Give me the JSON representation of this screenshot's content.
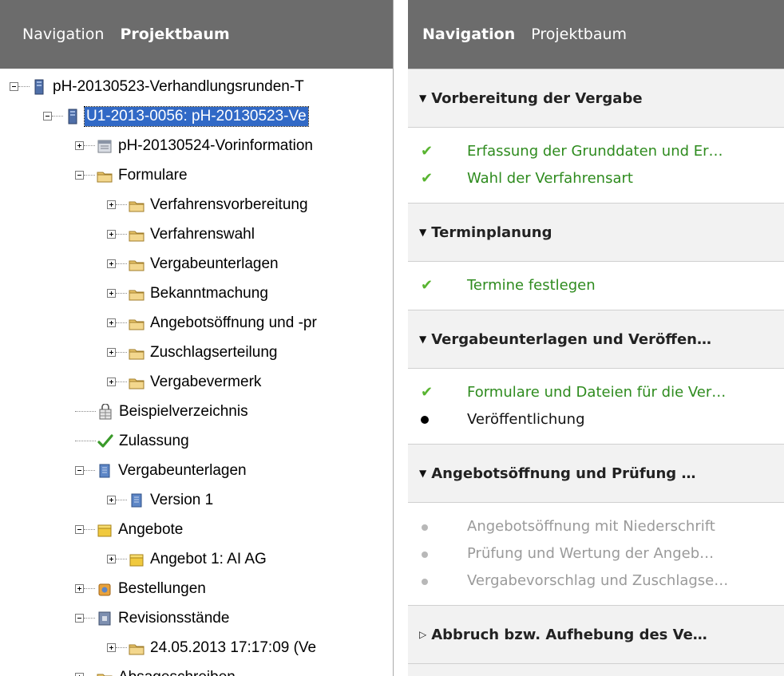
{
  "left_panel": {
    "tabs": [
      {
        "label": "Navigation",
        "active": false
      },
      {
        "label": "Projektbaum",
        "active": true
      }
    ],
    "tree": [
      {
        "label": "pH-20130523-Verhandlungsrunden-T",
        "icon": "server-icon",
        "state": "expanded",
        "level": 0
      },
      {
        "label": "U1-2013-0056:  pH-20130523-Ve",
        "icon": "server-icon",
        "state": "expanded",
        "level": 1,
        "selected": true
      },
      {
        "label": "pH-20130524-Vorinformation",
        "icon": "calendar-icon",
        "state": "collapsed",
        "level": 2
      },
      {
        "label": "Formulare",
        "icon": "folder-icon",
        "state": "expanded",
        "level": 2
      },
      {
        "label": "Verfahrensvorbereitung",
        "icon": "folder-icon",
        "state": "collapsed",
        "level": 3
      },
      {
        "label": "Verfahrenswahl",
        "icon": "folder-icon",
        "state": "collapsed",
        "level": 3
      },
      {
        "label": "Vergabeunterlagen",
        "icon": "folder-icon",
        "state": "collapsed",
        "level": 3
      },
      {
        "label": "Bekanntmachung",
        "icon": "folder-icon",
        "state": "collapsed",
        "level": 3
      },
      {
        "label": "Angebotsöffnung und -pr",
        "icon": "folder-icon",
        "state": "collapsed",
        "level": 3
      },
      {
        "label": "Zuschlagserteilung",
        "icon": "folder-icon",
        "state": "collapsed",
        "level": 3
      },
      {
        "label": "Vergabevermerk",
        "icon": "folder-icon",
        "state": "collapsed",
        "level": 3
      },
      {
        "label": "Beispielverzeichnis",
        "icon": "lock-table-icon",
        "state": "leaf",
        "level": 2
      },
      {
        "label": "Zulassung",
        "icon": "checkmark-icon",
        "state": "leaf",
        "level": 2
      },
      {
        "label": "Vergabeunterlagen",
        "icon": "document-icon",
        "state": "expanded",
        "level": 2
      },
      {
        "label": "Version 1",
        "icon": "document-icon",
        "state": "collapsed",
        "level": 3
      },
      {
        "label": "Angebote",
        "icon": "box-icon",
        "state": "expanded",
        "level": 2
      },
      {
        "label": "Angebot 1: AI AG",
        "icon": "box-icon",
        "state": "collapsed",
        "level": 3
      },
      {
        "label": "Bestellungen",
        "icon": "order-icon",
        "state": "collapsed",
        "level": 2
      },
      {
        "label": "Revisionsstände",
        "icon": "archive-icon",
        "state": "expanded",
        "level": 2
      },
      {
        "label": "24.05.2013 17:17:09 (Ve",
        "icon": "folder-icon",
        "state": "collapsed",
        "level": 3
      },
      {
        "label": "Absageschreiben",
        "icon": "folder-icon",
        "state": "collapsed",
        "level": 2
      }
    ]
  },
  "right_panel": {
    "tabs": [
      {
        "label": "Navigation",
        "active": true
      },
      {
        "label": "Projektbaum",
        "active": false
      }
    ],
    "sections": [
      {
        "title": "Vorbereitung der Vergabe",
        "expanded": true,
        "items": [
          {
            "label": "Erfassung der Grunddaten und Er…",
            "status": "done"
          },
          {
            "label": "Wahl der Verfahrensart",
            "status": "done"
          }
        ]
      },
      {
        "title": "Terminplanung",
        "expanded": true,
        "items": [
          {
            "label": "Termine festlegen",
            "status": "done"
          }
        ]
      },
      {
        "title": "Vergabeunterlagen und Veröffen…",
        "expanded": true,
        "items": [
          {
            "label": "Formulare und Dateien für die Ver…",
            "status": "done"
          },
          {
            "label": "Veröffentlichung",
            "status": "current"
          }
        ]
      },
      {
        "title": "Angebotsöffnung und Prüfung …",
        "expanded": true,
        "items": [
          {
            "label": "Angebotsöffnung mit Niederschrift",
            "status": "pending"
          },
          {
            "label": "Prüfung und Wertung der Angeb…",
            "status": "pending"
          },
          {
            "label": "Vergabevorschlag und Zuschlagse…",
            "status": "pending"
          }
        ]
      },
      {
        "title": "Abbruch bzw. Aufhebung des Ve…",
        "expanded": false,
        "items": []
      }
    ],
    "colors": {
      "done": "#2e8b1e",
      "check": "#58b430",
      "pending": "#9a9a9a",
      "header_bg": "#6c6c6c"
    }
  }
}
